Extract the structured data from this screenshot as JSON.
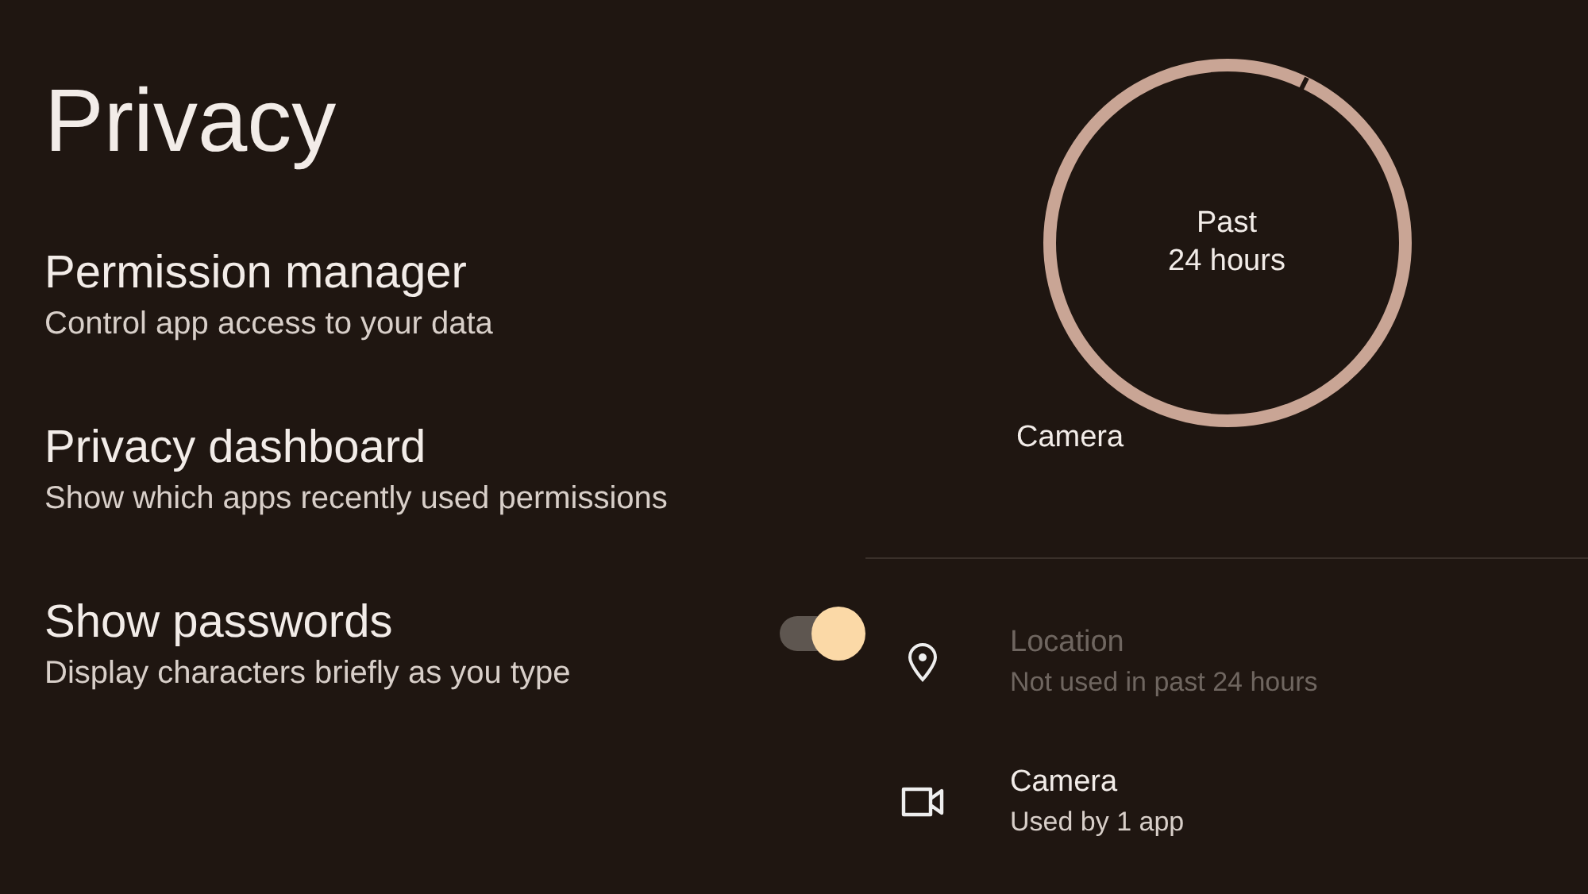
{
  "title": "Privacy",
  "settings": [
    {
      "title": "Permission manager",
      "subtitle": "Control app access to your data",
      "kind": "link"
    },
    {
      "title": "Privacy dashboard",
      "subtitle": "Show which apps recently used permissions",
      "kind": "link"
    },
    {
      "title": "Show passwords",
      "subtitle": "Display characters briefly as you type",
      "kind": "toggle",
      "on": true
    }
  ],
  "dashboard": {
    "ring_label": [
      "Past",
      "24 hours"
    ],
    "ring_caption": "Camera",
    "permissions": [
      {
        "name": "Location",
        "detail": "Not used in past 24 hours",
        "kind": "location",
        "disabled": true
      },
      {
        "name": "Camera",
        "detail": "Used by 1 app",
        "kind": "camera",
        "disabled": false
      }
    ]
  }
}
